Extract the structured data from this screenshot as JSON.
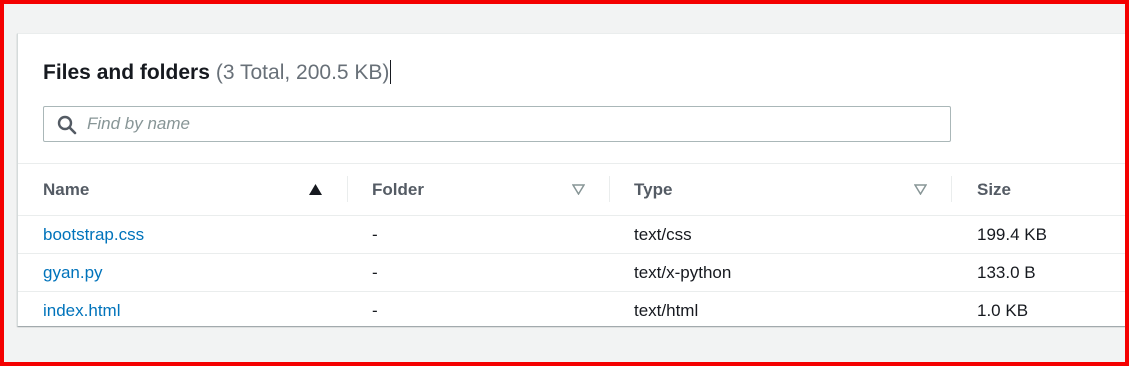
{
  "panel": {
    "title": "Files and folders",
    "counter": "(3 Total, 200.5 KB)"
  },
  "search": {
    "placeholder": "Find by name",
    "value": ""
  },
  "table": {
    "columns": [
      {
        "label": "Name",
        "sort": "ascending"
      },
      {
        "label": "Folder",
        "sort": "none"
      },
      {
        "label": "Type",
        "sort": "none"
      },
      {
        "label": "Size",
        "sort": "none"
      }
    ],
    "rows": [
      {
        "name": "bootstrap.css",
        "folder": "-",
        "type": "text/css",
        "size": "199.4 KB"
      },
      {
        "name": "gyan.py",
        "folder": "-",
        "type": "text/x-python",
        "size": "133.0 B"
      },
      {
        "name": "index.html",
        "folder": "-",
        "type": "text/html",
        "size": "1.0 KB"
      }
    ]
  },
  "colors": {
    "frame_border": "#f40000",
    "link": "#0073bb",
    "header_text": "#545b64",
    "muted": "#687078"
  },
  "icons": {
    "search": "search-icon",
    "sort_ascending": "sort-ascending-icon",
    "sort_none": "sort-descending-icon"
  }
}
